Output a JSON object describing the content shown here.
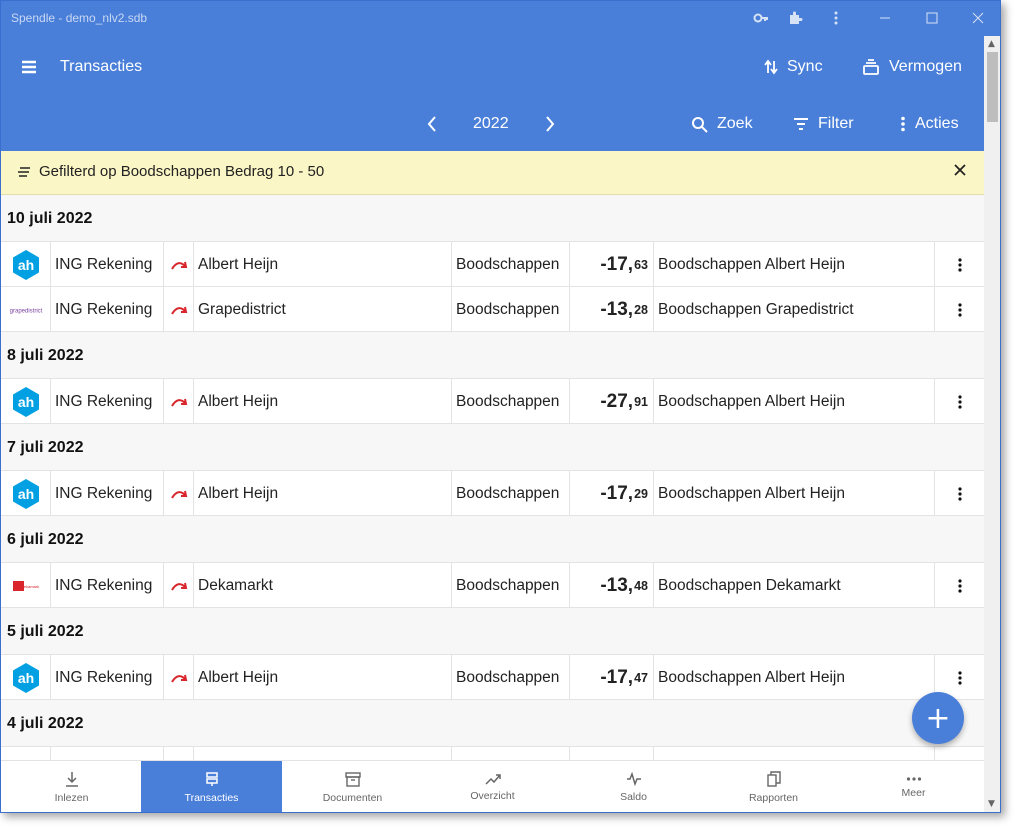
{
  "window": {
    "title": "Spendle - demo_nlv2.sdb"
  },
  "appbar": {
    "title": "Transacties",
    "sync_label": "Sync",
    "vermogen_label": "Vermogen",
    "year": "2022",
    "zoek_label": "Zoek",
    "filter_label": "Filter",
    "acties_label": "Acties"
  },
  "filterbar": {
    "text": "Gefilterd op Boodschappen Bedrag 10 - 50"
  },
  "dates": [
    "10 juli 2022",
    "8 juli 2022",
    "7 juli 2022",
    "6 juli 2022",
    "5 juli 2022",
    "4 juli 2022"
  ],
  "rows": [
    {
      "logo": "albert-heijn-logo",
      "account": "ING Rekening",
      "payee": "Albert Heijn",
      "category": "Boodschappen",
      "amount_main": "-17,",
      "amount_cents": "63",
      "description": "Boodschappen Albert Heijn"
    },
    {
      "logo": "grapedistrict-logo",
      "logo_text": "grapedistrict",
      "account": "ING Rekening",
      "payee": "Grapedistrict",
      "category": "Boodschappen",
      "amount_main": "-13,",
      "amount_cents": "28",
      "description": "Boodschappen Grapedistrict"
    },
    {
      "logo": "albert-heijn-logo",
      "account": "ING Rekening",
      "payee": "Albert Heijn",
      "category": "Boodschappen",
      "amount_main": "-27,",
      "amount_cents": "91",
      "description": "Boodschappen Albert Heijn"
    },
    {
      "logo": "albert-heijn-logo",
      "account": "ING Rekening",
      "payee": "Albert Heijn",
      "category": "Boodschappen",
      "amount_main": "-17,",
      "amount_cents": "29",
      "description": "Boodschappen Albert Heijn"
    },
    {
      "logo": "dekamarkt-logo",
      "logo_text": "dekamarkt",
      "account": "ING Rekening",
      "payee": "Dekamarkt",
      "category": "Boodschappen",
      "amount_main": "-13,",
      "amount_cents": "48",
      "description": "Boodschappen Dekamarkt"
    },
    {
      "logo": "albert-heijn-logo",
      "account": "ING Rekening",
      "payee": "Albert Heijn",
      "category": "Boodschappen",
      "amount_main": "-17,",
      "amount_cents": "47",
      "description": "Boodschappen Albert Heijn"
    }
  ],
  "bottomnav": {
    "inlezen": "Inlezen",
    "transacties": "Transacties",
    "documenten": "Documenten",
    "overzicht": "Overzicht",
    "saldo": "Saldo",
    "rapporten": "Rapporten",
    "meer": "Meer"
  },
  "fab": {
    "label": "+"
  },
  "colors": {
    "primary": "#4a7fd9",
    "filter_bg": "#fbf6c6",
    "ah_blue": "#00a0e2",
    "transfer_red": "#d9262c"
  }
}
